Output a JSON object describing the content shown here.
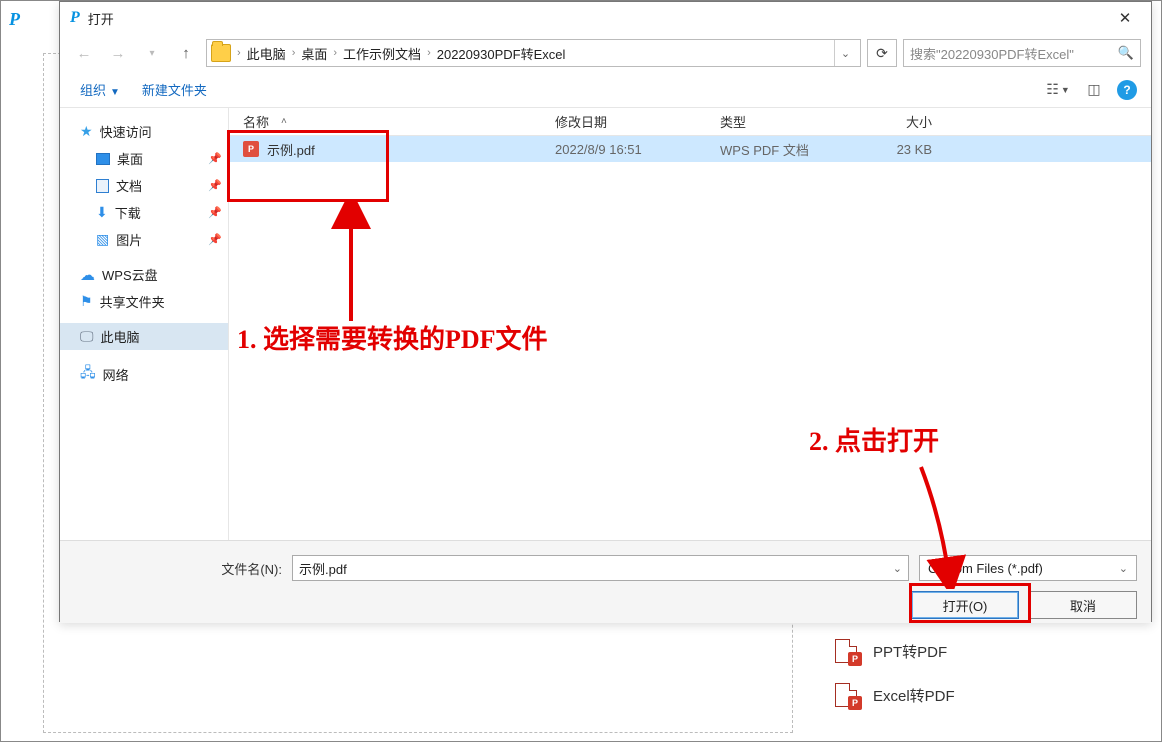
{
  "dialog": {
    "title": "打开",
    "close_label": "✕",
    "nav": {
      "crumbs": [
        "此电脑",
        "桌面",
        "工作示例文档",
        "20220930PDF转Excel"
      ],
      "search_placeholder": "搜索\"20220930PDF转Excel\""
    },
    "toolbar": {
      "organize": "组织",
      "new_folder": "新建文件夹"
    },
    "tree": {
      "quick_access": "快速访问",
      "desktop": "桌面",
      "documents": "文档",
      "downloads": "下载",
      "pictures": "图片",
      "wps_cloud": "WPS云盘",
      "shared": "共享文件夹",
      "this_pc": "此电脑",
      "network": "网络"
    },
    "columns": {
      "name": "名称",
      "date": "修改日期",
      "type": "类型",
      "size": "大小"
    },
    "rows": [
      {
        "name": "示例.pdf",
        "date": "2022/8/9 16:51",
        "type": "WPS PDF 文档",
        "size": "23 KB"
      }
    ],
    "footer": {
      "fn_label": "文件名(N):",
      "fn_value": "示例.pdf",
      "filter": "Custom Files (*.pdf)",
      "open": "打开(O)",
      "cancel": "取消"
    }
  },
  "annotations": {
    "step1": "1. 选择需要转换的PDF文件",
    "step2": "2. 点击打开"
  },
  "background_items": {
    "ppt": "PPT转PDF",
    "excel": "Excel转PDF"
  }
}
